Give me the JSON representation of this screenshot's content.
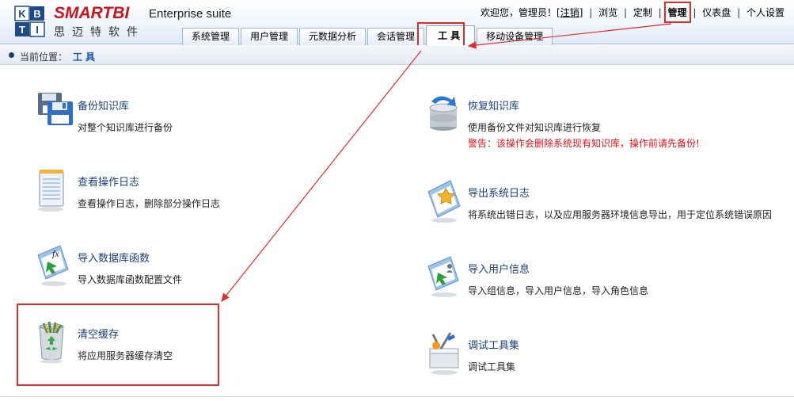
{
  "header": {
    "logo_glyphs": [
      "K",
      "B",
      "T",
      "I"
    ],
    "brand": "SMARTBI",
    "brand_cn": "思迈特软件",
    "edition": "Enterprise suite"
  },
  "topnav": {
    "welcome": "欢迎您，管理员！[",
    "logout": "注销",
    "welcome_end": "]",
    "sep": "|",
    "items": [
      "浏览",
      "定制",
      "管理",
      "仪表盘",
      "个人设置"
    ]
  },
  "tabs": [
    {
      "label": "系统管理"
    },
    {
      "label": "用户管理"
    },
    {
      "label": "元数据分析"
    },
    {
      "label": "会话管理"
    },
    {
      "label": "工具"
    },
    {
      "label": "移动设备管理"
    }
  ],
  "breadcrumb": {
    "label": "当前位置：",
    "value": "工具"
  },
  "tools": {
    "backup": {
      "title": "备份知识库",
      "desc": "对整个知识库进行备份"
    },
    "restore": {
      "title": "恢复知识库",
      "desc": "使用备份文件对知识库进行恢复",
      "warning": "警告：该操作会删除系统现有知识库，操作前请先备份!"
    },
    "view_log": {
      "title": "查看操作日志",
      "desc": "查看操作日志，删除部分操作日志"
    },
    "export_log": {
      "title": "导出系统日志",
      "desc": "将系统出错日志，以及应用服务器环境信息导出，用于定位系统错误原因"
    },
    "import_func": {
      "title": "导入数据库函数",
      "desc": "导入数据库函数配置文件"
    },
    "import_user": {
      "title": "导入用户信息",
      "desc": "导入组信息，导入用户信息，导入角色信息"
    },
    "clear_cache": {
      "title": "清空缓存",
      "desc": "将应用服务器缓存清空"
    },
    "debug_tools": {
      "title": "调试工具集",
      "desc": "调试工具集"
    }
  },
  "colors": {
    "brand_red": "#c8161d",
    "link_blue": "#1a3d7c",
    "warning_red": "#e0101a",
    "annotation_red": "#e12b2b"
  },
  "icons": {
    "backup": "floppy-disk-icon",
    "restore": "database-restore-icon",
    "view_log": "notepad-icon",
    "export_log": "export-document-icon",
    "import_func": "function-import-icon",
    "import_user": "user-import-icon",
    "clear_cache": "recycle-bin-icon",
    "debug_tools": "toolbox-icon"
  }
}
